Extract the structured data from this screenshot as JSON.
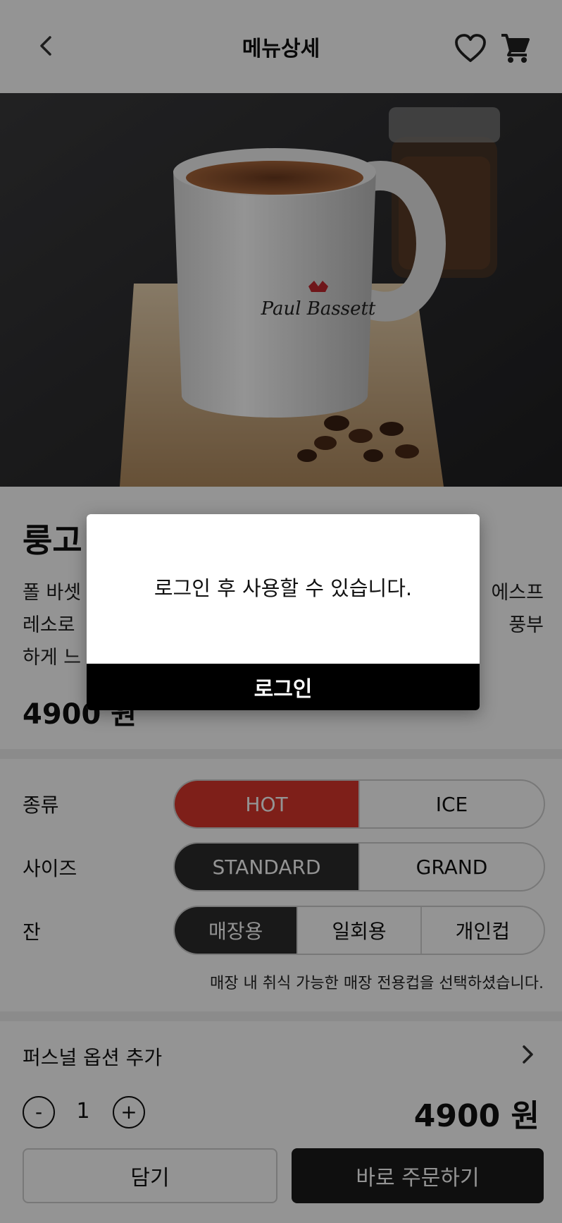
{
  "header": {
    "title": "메뉴상세",
    "back_icon": "chevron-left-icon",
    "favorite_icon": "heart-outline-icon",
    "cart_icon": "shopping-cart-icon"
  },
  "product": {
    "image_icon": "coffee-mug-photo",
    "name": "룽고",
    "description": "폴 바셋 에스프레소로 ... 풍부하게 느",
    "desc_line1": "폴 바셋",
    "desc_line1_right": "에스프",
    "desc_line2": "레소로",
    "desc_line2_right": "풍부",
    "desc_line3": "하게 느",
    "price": "4900 원"
  },
  "options": {
    "type": {
      "label": "종류",
      "choices": [
        "HOT",
        "ICE"
      ],
      "selected": "HOT"
    },
    "size": {
      "label": "사이즈",
      "choices": [
        "STANDARD",
        "GRAND"
      ],
      "selected": "STANDARD"
    },
    "cup": {
      "label": "잔",
      "choices": [
        "매장용",
        "일회용",
        "개인컵"
      ],
      "selected": "매장용"
    },
    "cup_note": "매장 내 취식 가능한 매장 전용컵을 선택하셨습니다."
  },
  "personal_option": {
    "label": "퍼스널 옵션 추가",
    "icon": "chevron-right-icon"
  },
  "order": {
    "minus_label": "-",
    "quantity": "1",
    "plus_label": "+",
    "total": "4900 원",
    "add_to_cart_label": "담기",
    "order_now_label": "바로 주문하기"
  },
  "modal": {
    "message": "로그인 후 사용할 수 있습니다.",
    "button_label": "로그인"
  },
  "colors": {
    "accent_red": "#d9362b",
    "selected_dark": "#2b2b2b",
    "overlay": "rgba(0,0,0,0.42)"
  }
}
